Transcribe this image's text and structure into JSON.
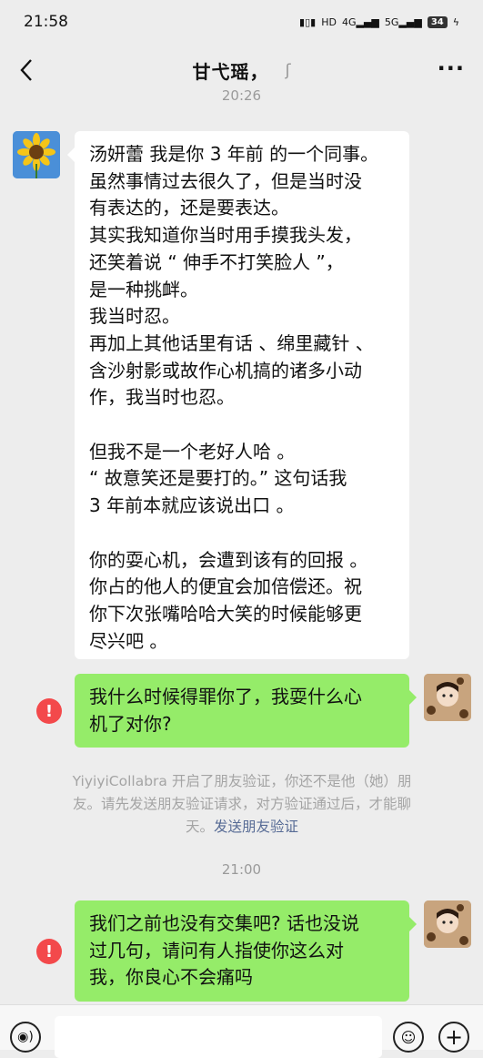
{
  "status_bar": {
    "time": "21:58",
    "signal_labels": [
      "HD",
      "4G",
      "5G"
    ],
    "battery": "34"
  },
  "header": {
    "title": "甘弋瑶，",
    "more_label": "···"
  },
  "timestamps": [
    "20:26",
    "21:00"
  ],
  "messages": [
    {
      "side": "left",
      "lines": [
        "汤妍蕾 我是你 3 年前 的一个同事。",
        "虽然事情过去很久了，但是当时没",
        "有表达的，还是要表达。",
        "其实我知道你当时用手摸我头发，",
        "还笑着说 “ 伸手不打笑脸人 ”，",
        "是一种挑衅。",
        "我当时忍。",
        "再加上其他话里有话 、绵里藏针 、",
        "含沙射影或故作心机搞的诸多小动",
        "作，我当时也忍。",
        "",
        "但我不是一个老好人哈 。",
        "“ 故意笑还是要打的。” 这句话我",
        "3 年前本就应该说出口 。",
        "",
        "你的耍心机，会遭到该有的回报 。",
        "你占的他人的便宜会加倍偿还。祝",
        "你下次张嘴哈哈大笑的时候能够更",
        "尽兴吧 。"
      ]
    },
    {
      "side": "right",
      "error": "!",
      "lines": [
        "我什么时候得罪你了，我耍什么心",
        "机了对你?"
      ]
    },
    {
      "side": "right",
      "error": "!",
      "lines": [
        "我们之前也没有交集吧? 话也没说",
        "过几句，请问有人指使你这么对",
        "我，你良心不会痛吗"
      ]
    }
  ],
  "system_notice": {
    "lines": [
      "YiyiyiCollabra 开启了朋友验证，你还不是他（她）朋",
      "友。请先发送朋友验证请求，对方验证通过后，才能聊",
      "天。"
    ],
    "link": "发送朋友验证"
  },
  "input_bar": {
    "voice_icon": "voice-icon",
    "emoji_icon": "emoji-icon",
    "plus_icon": "plus-icon"
  }
}
